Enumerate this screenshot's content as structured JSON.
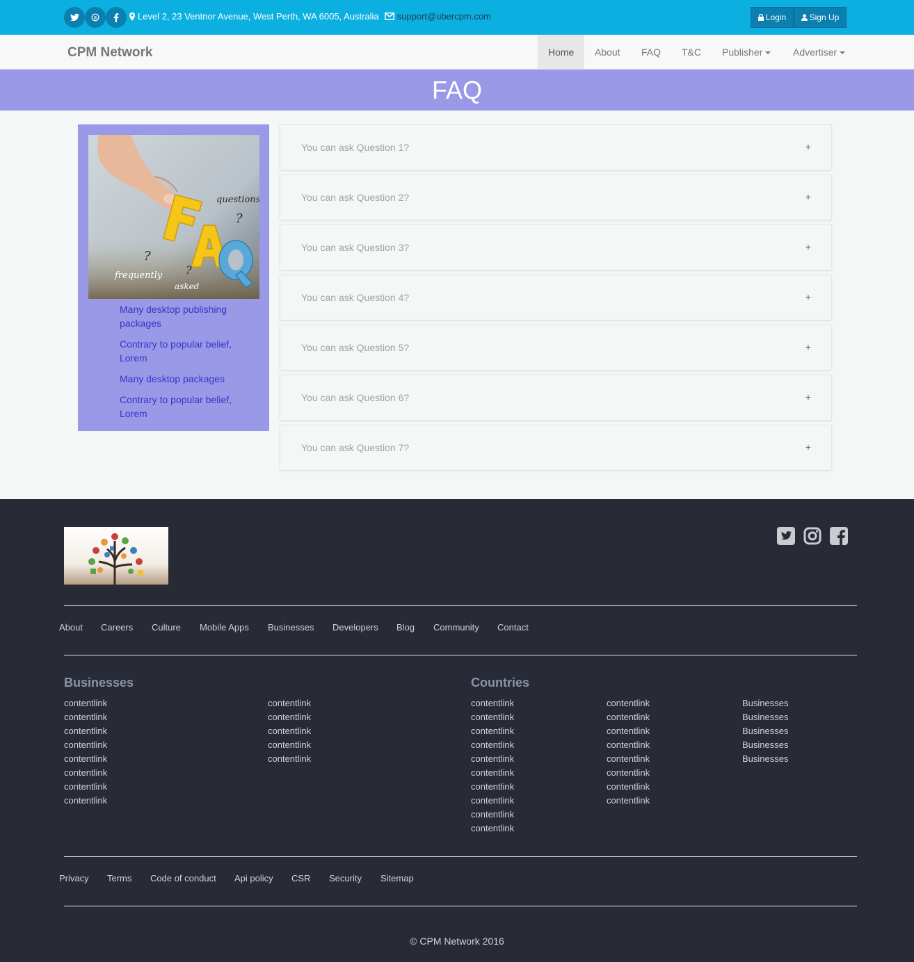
{
  "topbar": {
    "social": [
      "twitter-icon",
      "skype-icon",
      "facebook-icon"
    ],
    "address": "Level 2, 23 Ventnor Avenue, West Perth, WA 6005, Australia",
    "email": "support@ubercpm.com",
    "login": "Login",
    "signup": "Sign Up",
    "colors": {
      "bar": "#0bafe0",
      "circle": "#0a7fb0"
    }
  },
  "navbar": {
    "brand": "CPM Network",
    "items": [
      "Home",
      "About",
      "FAQ",
      "T&C",
      "Publisher",
      "Advertiser"
    ],
    "active": "Home"
  },
  "page": {
    "title": "FAQ",
    "accent": "#9999e8"
  },
  "sidebar": {
    "image_text": {
      "letters": "FAQ",
      "frequently": "frequently",
      "asked": "asked",
      "questions": "questions"
    },
    "links": [
      "Many desktop publishing packages",
      "Contrary to popular belief, Lorem",
      "Many desktop packages",
      "Contrary to popular belief, Lorem"
    ]
  },
  "faq": {
    "questions": [
      "You can ask Question 1?",
      "You can ask Question 2?",
      "You can ask Question 3?",
      "You can ask Question 4?",
      "You can ask Question 5?",
      "You can ask Question 6?",
      "You can ask Question 7?"
    ],
    "toggle": "+"
  },
  "footer": {
    "social": [
      "twitter-icon",
      "instagram-icon",
      "facebook-icon"
    ],
    "nav": [
      "About",
      "Careers",
      "Culture",
      "Mobile Apps",
      "Businesses",
      "Developers",
      "Blog",
      "Community",
      "Contact"
    ],
    "businesses_heading": "Businesses",
    "countries_heading": "Countries",
    "businesses_col1": [
      "contentlink",
      "contentlink",
      "contentlink",
      "contentlink",
      "contentlink",
      "contentlink",
      "contentlink",
      "contentlink"
    ],
    "businesses_col2": [
      "contentlink",
      "contentlink",
      "contentlink",
      "contentlink",
      "contentlink"
    ],
    "countries_col1": [
      "contentlink",
      "contentlink",
      "contentlink",
      "contentlink",
      "contentlink",
      "contentlink",
      "contentlink",
      "contentlink",
      "contentlink",
      "contentlink"
    ],
    "countries_col2": [
      "contentlink",
      "contentlink",
      "contentlink",
      "contentlink",
      "contentlink",
      "contentlink",
      "contentlink",
      "contentlink"
    ],
    "countries_col3": [
      "Businesses",
      "Businesses",
      "Businesses",
      "Businesses",
      "Businesses"
    ],
    "legal": [
      "Privacy",
      "Terms",
      "Code of conduct",
      "Api policy",
      "CSR",
      "Security",
      "Sitemap"
    ],
    "copyright": "© CPM Network 2016",
    "bg": "#282b35"
  }
}
